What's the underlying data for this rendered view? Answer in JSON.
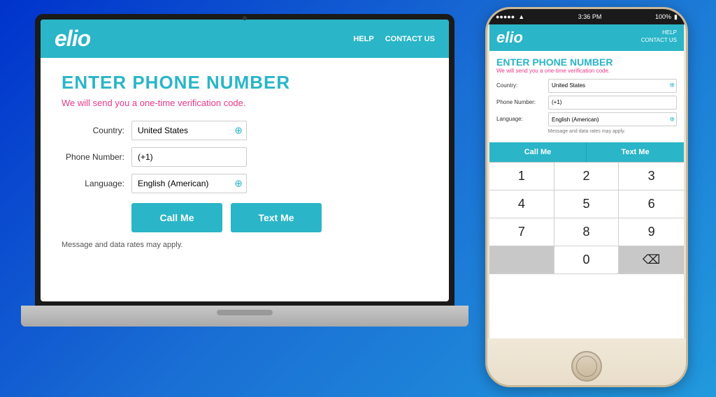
{
  "brand": {
    "logo": "elio",
    "tagline": "ENTER PHONE NUMBER",
    "subtitle": "We will send you a one-time verification code."
  },
  "nav": {
    "help": "HELP",
    "contact": "CONTACT US"
  },
  "form": {
    "country_label": "Country:",
    "country_value": "United States",
    "phone_label": "Phone Number:",
    "phone_value": "(+1)",
    "language_label": "Language:",
    "language_value": "English (American)"
  },
  "buttons": {
    "call_me": "Call Me",
    "text_me": "Text Me"
  },
  "disclaimer": "Message and data rates may apply.",
  "phone_status": {
    "time": "3:36 PM",
    "battery": "100%",
    "signal": "●●●●●"
  },
  "keypad": {
    "keys": [
      "1",
      "2",
      "3",
      "4",
      "5",
      "6",
      "7",
      "8",
      "9",
      "",
      "0",
      "⌫"
    ]
  }
}
